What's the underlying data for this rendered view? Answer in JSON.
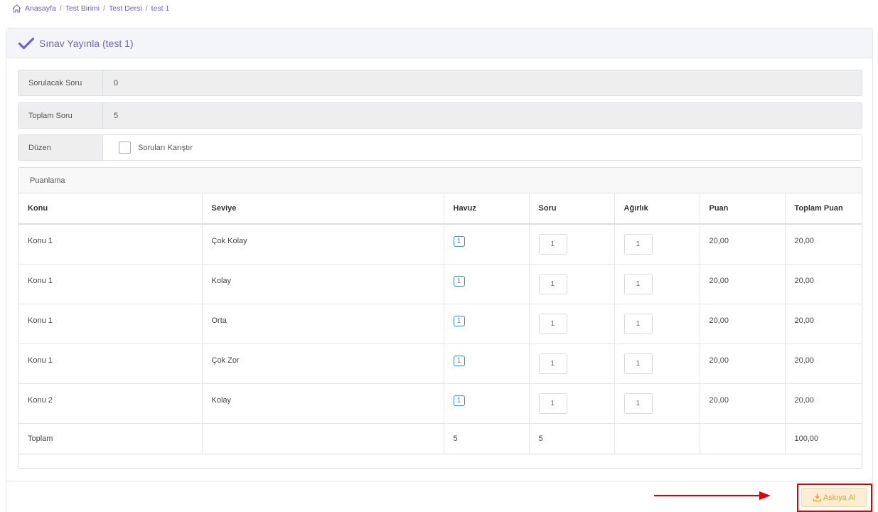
{
  "breadcrumb": {
    "items": [
      "Anasayfa",
      "Test Birimi",
      "Test Dersi",
      "test 1"
    ],
    "separator": "/",
    "icon": "home-icon"
  },
  "header": {
    "title": "Sınav Yayınla (test 1)",
    "icon": "check-icon",
    "accent_color": "#7064c8"
  },
  "info": {
    "asked_label": "Sorulacak Soru",
    "asked_value": "0",
    "total_label": "Toplam Soru",
    "total_value": "5",
    "order_label": "Düzen",
    "shuffle_label": "Soruları Karıştır",
    "shuffle_checked": false
  },
  "scoring": {
    "title": "Puanlama",
    "columns": [
      "Konu",
      "Seviye",
      "Havuz",
      "Soru",
      "Ağırlık",
      "Puan",
      "Toplam Puan"
    ],
    "rows": [
      {
        "topic": "Konu 1",
        "level": "Çok Kolay",
        "pool": "1",
        "questions": "1",
        "weight": "1",
        "score": "20,00",
        "total_score": "20,00"
      },
      {
        "topic": "Konu 1",
        "level": "Kolay",
        "pool": "1",
        "questions": "1",
        "weight": "1",
        "score": "20,00",
        "total_score": "20,00"
      },
      {
        "topic": "Konu 1",
        "level": "Orta",
        "pool": "1",
        "questions": "1",
        "weight": "1",
        "score": "20,00",
        "total_score": "20,00"
      },
      {
        "topic": "Konu 1",
        "level": "Çok Zor",
        "pool": "1",
        "questions": "1",
        "weight": "1",
        "score": "20,00",
        "total_score": "20,00"
      },
      {
        "topic": "Konu 2",
        "level": "Kolay",
        "pool": "1",
        "questions": "1",
        "weight": "1",
        "score": "20,00",
        "total_score": "20,00"
      }
    ],
    "total": {
      "label": "Toplam",
      "pool": "5",
      "questions": "5",
      "weight": "",
      "score": "",
      "total_score": "100,00"
    }
  },
  "actions": {
    "suspend_label": "Askıya Al",
    "suspend_icon": "download-icon",
    "highlight_color": "#e00000",
    "button_color": "#f0a030"
  }
}
